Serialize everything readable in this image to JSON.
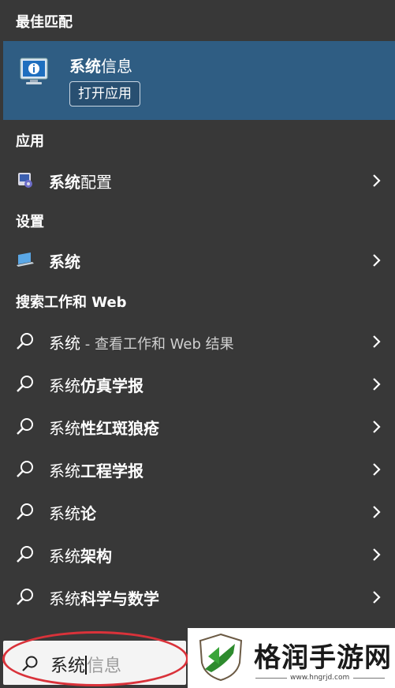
{
  "sections": {
    "best_match": "最佳匹配",
    "apps": "应用",
    "settings": "设置",
    "web": "搜索工作和 Web"
  },
  "best_match": {
    "title": "系统信息",
    "title_hl": "系统",
    "title_rest": "信息",
    "open_button": "打开应用",
    "icon": "system-information-icon"
  },
  "apps": [
    {
      "hl": "系统",
      "rest": "配置",
      "icon": "system-config-icon"
    }
  ],
  "settings": [
    {
      "hl": "系统",
      "rest": "",
      "icon": "laptop-system-icon"
    }
  ],
  "web_results": [
    {
      "hl": "系统",
      "rest": "",
      "sub": " - 查看工作和 Web 结果"
    },
    {
      "hl": "系统",
      "rest": "仿真学报",
      "sub": ""
    },
    {
      "hl": "系统",
      "rest": "性红斑狼疮",
      "sub": ""
    },
    {
      "hl": "系统",
      "rest": "工程学报",
      "sub": ""
    },
    {
      "hl": "系统",
      "rest": "论",
      "sub": ""
    },
    {
      "hl": "系统",
      "rest": "架构",
      "sub": ""
    },
    {
      "hl": "系统",
      "rest": "科学与数学",
      "sub": ""
    }
  ],
  "search": {
    "typed": "系统",
    "placeholder_rest": "信息"
  },
  "watermark": {
    "title": "格润手游网",
    "url": "www.hngrjd.com"
  },
  "colors": {
    "panel_bg": "#383838",
    "highlight_bg": "#2f5d83",
    "annotation_ring": "#d9323a",
    "logo_green": "#2e8b2e"
  }
}
